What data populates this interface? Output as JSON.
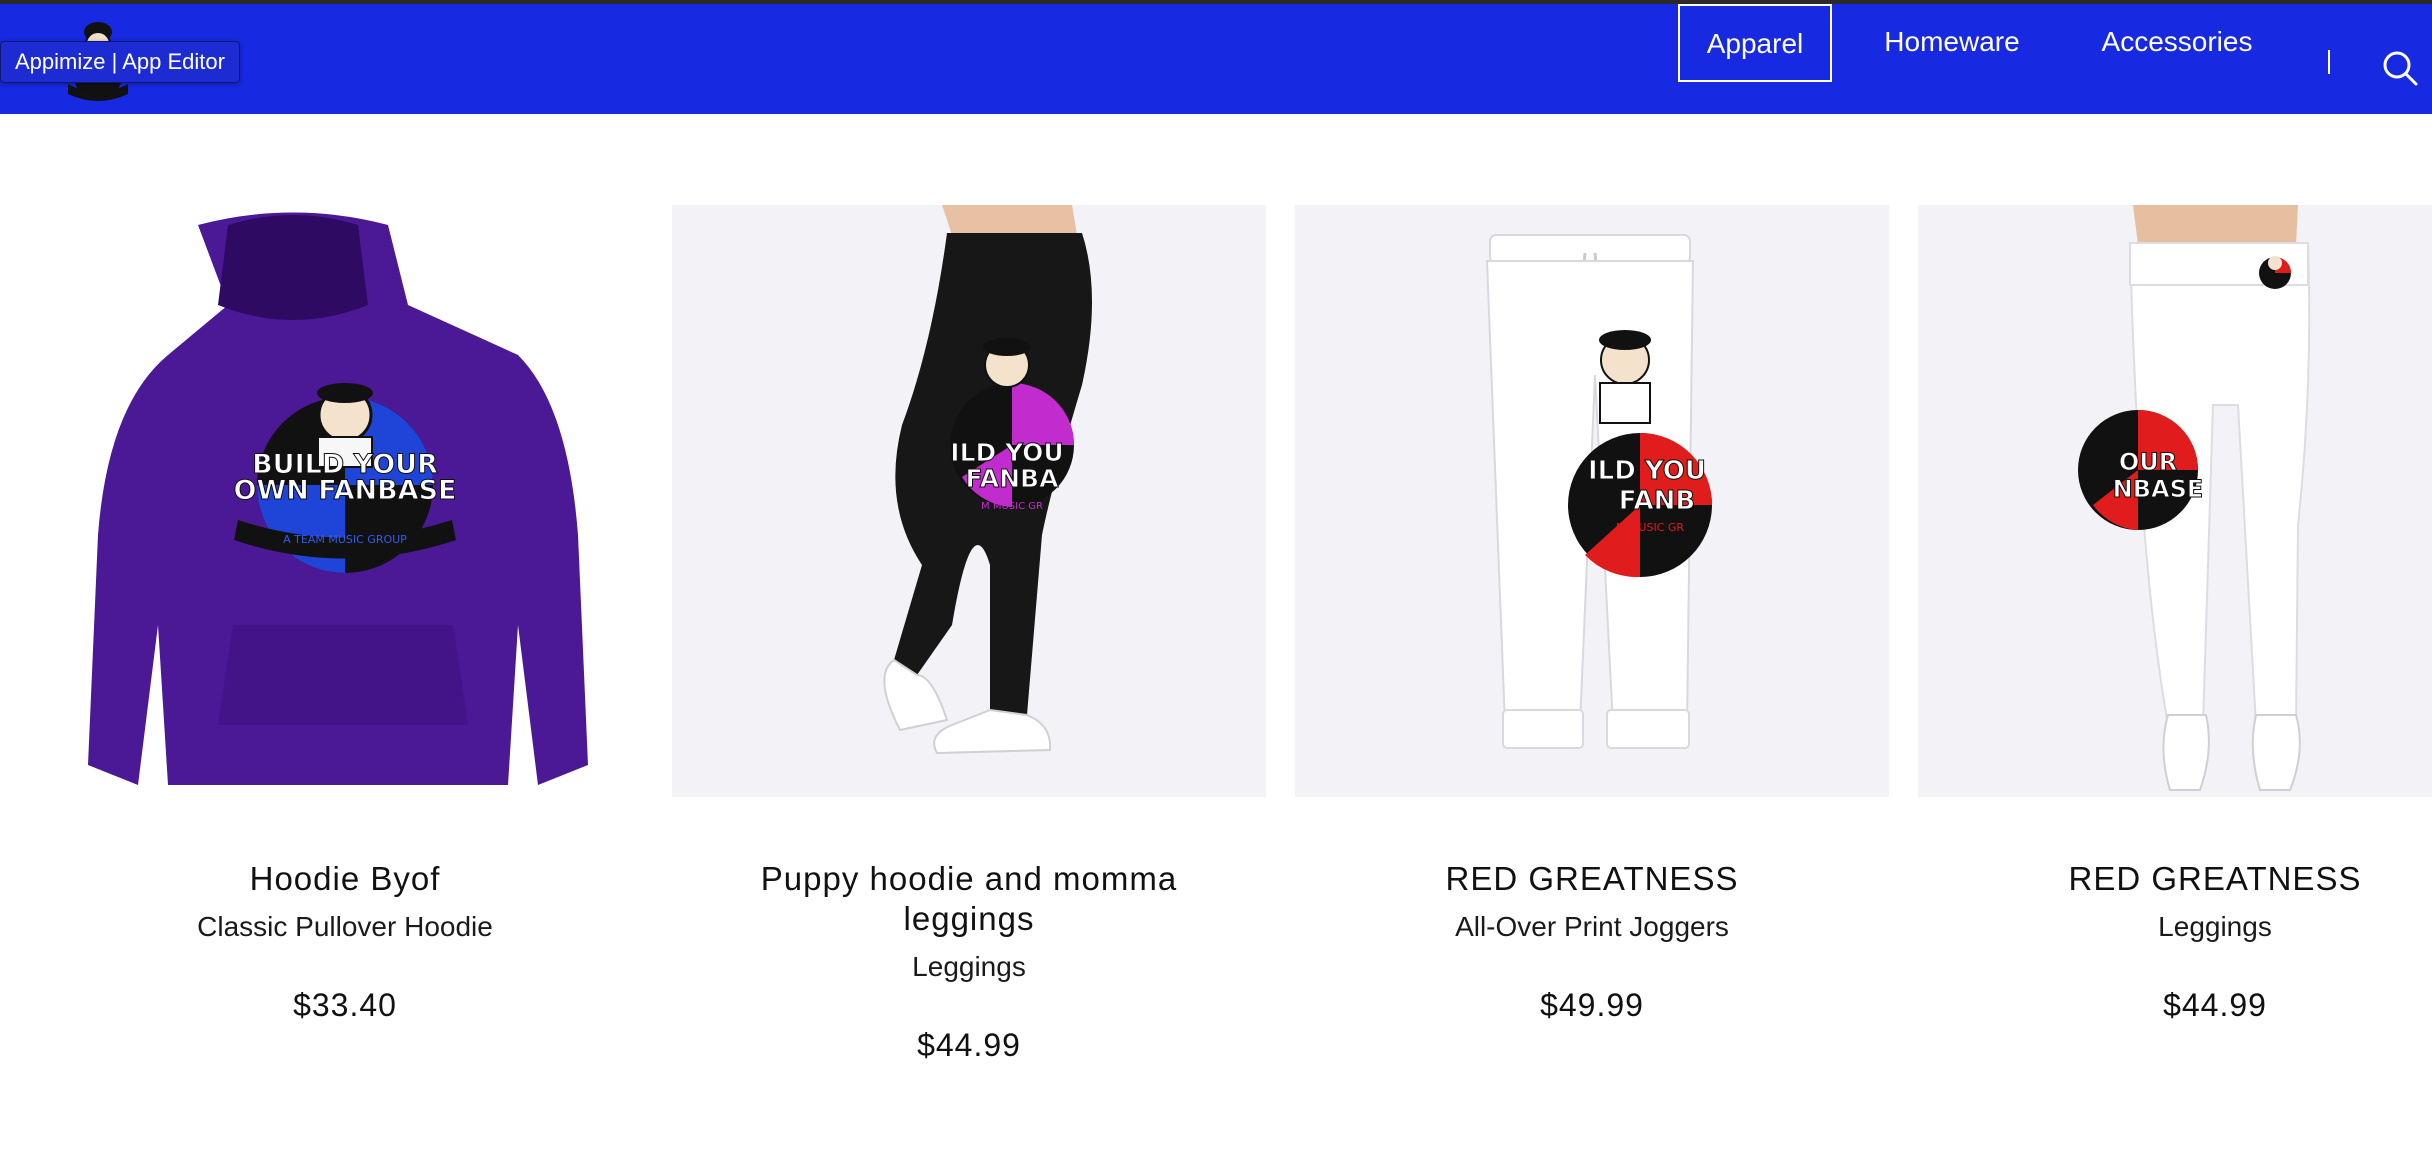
{
  "app": {
    "editor_label": "Appimize | App Editor"
  },
  "nav": {
    "items": [
      {
        "label": "Apparel",
        "active": true
      },
      {
        "label": "Homeware",
        "active": false
      },
      {
        "label": "Accessories",
        "active": false
      }
    ],
    "search_icon": "search-icon"
  },
  "colors": {
    "header_bg": "#1729e1",
    "image_bg": "#f3f3f7"
  },
  "products": [
    {
      "title": "Hoodie Byof",
      "subtitle": "Classic Pullover Hoodie",
      "price": "$33.40"
    },
    {
      "title": "Puppy hoodie and momma leggings",
      "subtitle": "Leggings",
      "price": "$44.99"
    },
    {
      "title": "RED GREATNESS",
      "subtitle": "All-Over Print Joggers",
      "price": "$49.99"
    },
    {
      "title": "RED GREATNESS",
      "subtitle": "Leggings",
      "price": "$44.99"
    }
  ],
  "artwork": {
    "hoodie_line1": "BUILD YOUR",
    "hoodie_line2": "OWN FANBASE",
    "hoodie_line3": "A TEAM MUSIC GROUP",
    "leggings_line1": "ILD YOU",
    "leggings_line2": "FANBA",
    "leggings_line3": "M MUSIC GR",
    "joggers_line1": "ILD YOU",
    "joggers_line2": "FANB",
    "joggers_line3": "M MUSIC GR",
    "red_leggings_line1": "OUR",
    "red_leggings_line2": "NBASE"
  }
}
